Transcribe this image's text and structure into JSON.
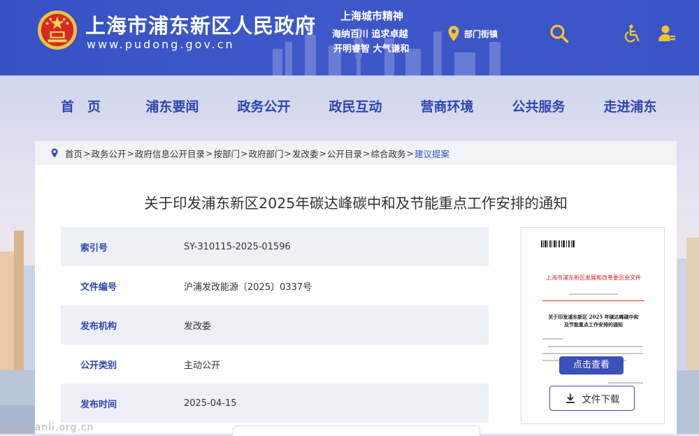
{
  "header": {
    "site_title": "上海市浦东新区人民政府",
    "site_url": "www.pudong.gov.cn",
    "spirit": {
      "title": "上海城市精神",
      "line1": "海纳百川  追求卓越",
      "line2": "开明睿智  大气谦和"
    },
    "dept_link": "部门街镇",
    "icons": [
      "location-pin-icon",
      "search-icon",
      "accessibility-icon",
      "user-icon"
    ],
    "colors": {
      "header_bg": "#3f58c9",
      "accent": "#2d45b2"
    }
  },
  "nav": {
    "items": [
      "首　页",
      "浦东要闻",
      "政务公开",
      "政民互动",
      "营商环境",
      "公共服务",
      "走进浦东"
    ]
  },
  "breadcrumb": {
    "items": [
      "首页",
      "政务公开",
      "政府信息公开目录",
      "按部门",
      "政府部门",
      "发改委",
      "公开目录",
      "综合政务"
    ],
    "last": "建议提案",
    "sep": ">"
  },
  "document": {
    "title": "关于印发浦东新区2025年碳达峰碳中和及节能重点工作安排的通知",
    "info": {
      "index_label": "索引号",
      "index_value": "SY-310115-2025-01596",
      "docno_label": "文件编号",
      "docno_value": "沪浦发改能源〔2025〕0337号",
      "issuer_label": "发布机构",
      "issuer_value": "发改委",
      "category_label": "公开类别",
      "category_value": "主动公开",
      "date_label": "发布时间",
      "date_value": "2025-04-15"
    }
  },
  "preview": {
    "doc_header": "上海市浦东新区发展和改革委员会文件",
    "doc_title_line1": "关于印发浦东新区 2025 年碳达峰碳中和",
    "doc_title_line2": "及节能重点工作安排的通知",
    "view_button": "点击查看",
    "download_button": "文件下载"
  },
  "watermark": "tanguanli.org.cn"
}
